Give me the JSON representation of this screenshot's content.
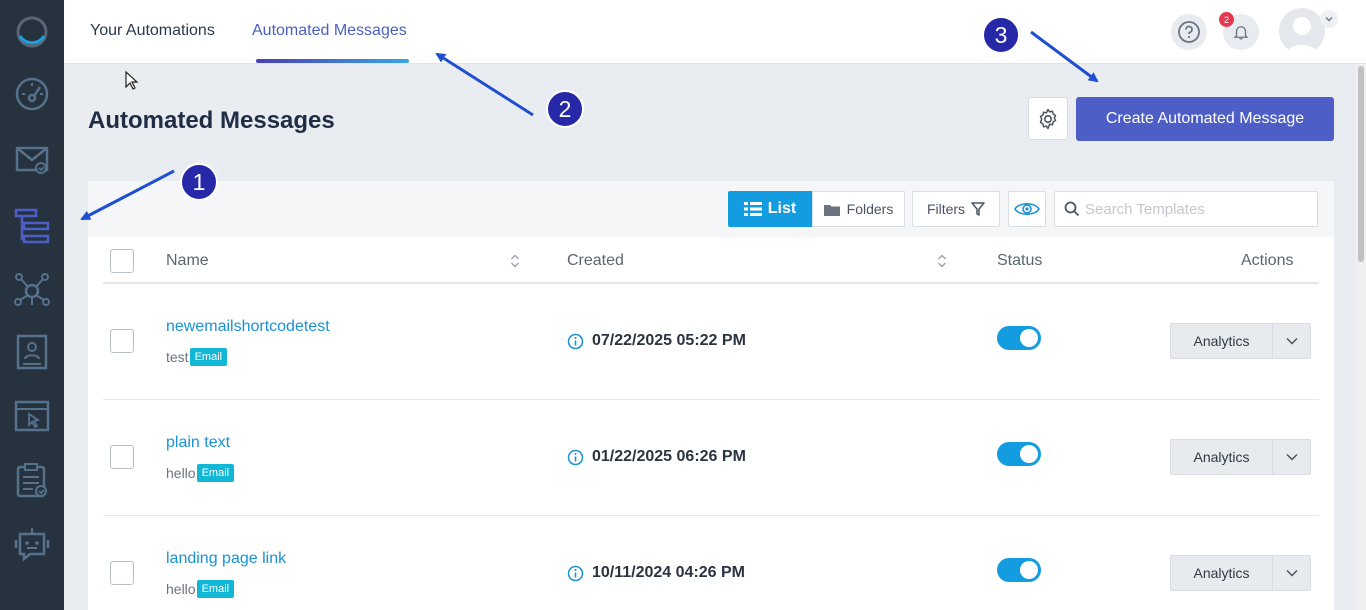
{
  "nav": {
    "tabs": [
      {
        "label": "Your Automations"
      },
      {
        "label": "Automated Messages"
      }
    ],
    "help_icon": "question-circle-icon",
    "notifications": {
      "count": "2"
    }
  },
  "sidebar": {
    "items": [
      {
        "icon": "loading-ring-logo"
      },
      {
        "icon": "dashboard-gauge-icon"
      },
      {
        "icon": "email-check-icon"
      },
      {
        "icon": "automation-flow-icon"
      },
      {
        "icon": "network-hub-icon"
      },
      {
        "icon": "contact-card-icon"
      },
      {
        "icon": "browser-pointer-icon"
      },
      {
        "icon": "clipboard-check-icon"
      },
      {
        "icon": "chatbot-icon"
      }
    ]
  },
  "page": {
    "title": "Automated Messages",
    "create_button": "Create Automated Message"
  },
  "toolbar": {
    "list_label": "List",
    "folders_label": "Folders",
    "filters_label": "Filters",
    "search_placeholder": "Search Templates"
  },
  "table": {
    "columns": [
      "Name",
      "Created",
      "Status",
      "Actions"
    ],
    "rows": [
      {
        "name": "newemailshortcodetest",
        "subtext": "test",
        "badge": "Email",
        "created": "07/22/2025 05:22 PM",
        "status_on": true,
        "action": "Analytics"
      },
      {
        "name": "plain text",
        "subtext": "hello",
        "badge": "Email",
        "created": "01/22/2025 06:26 PM",
        "status_on": true,
        "action": "Analytics"
      },
      {
        "name": "landing page link",
        "subtext": "hello",
        "badge": "Email",
        "created": "10/11/2024 04:26 PM",
        "status_on": true,
        "action": "Analytics"
      }
    ]
  },
  "annotations": [
    "1",
    "2",
    "3"
  ],
  "colors": {
    "sidebar": "#27323f",
    "primary": "#4d5ec6",
    "accent": "#139ce0",
    "annotation": "#2628a8"
  }
}
